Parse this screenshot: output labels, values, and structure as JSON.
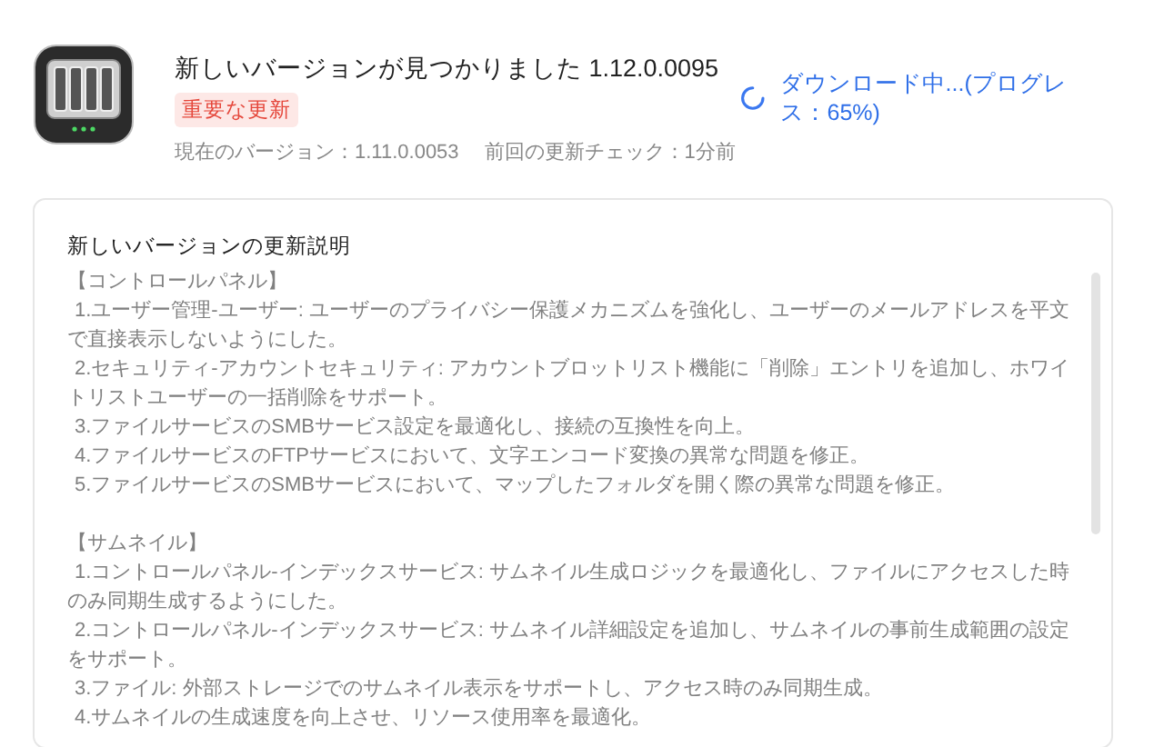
{
  "update": {
    "title": "新しいバージョンが見つかりました 1.12.0.0095",
    "badge": "重要な更新",
    "current_version": "現在のバージョン：1.11.0.0053",
    "last_check": "前回の更新チェック：1分前",
    "status": "ダウンロード中...(プログレス：65%)"
  },
  "notes": {
    "heading": "新しいバージョンの更新説明",
    "sections": [
      {
        "title": "【コントロールパネル】",
        "items": [
          "1.ユーザー管理-ユーザー: ユーザーのプライバシー保護メカニズムを強化し、ユーザーのメールアドレスを平文で直接表示しないようにした。",
          "2.セキュリティ-アカウントセキュリティ: アカウントブロットリスト機能に「削除」エントリを追加し、ホワイトリストユーザーの一括削除をサポート。",
          "3.ファイルサービスのSMBサービス設定を最適化し、接続の互換性を向上。",
          "4.ファイルサービスのFTPサービスにおいて、文字エンコード変換の異常な問題を修正。",
          "5.ファイルサービスのSMBサービスにおいて、マップしたフォルダを開く際の異常な問題を修正。"
        ]
      },
      {
        "title": "【サムネイル】",
        "items": [
          "1.コントロールパネル-インデックスサービス: サムネイル生成ロジックを最適化し、ファイルにアクセスした時のみ同期生成するようにした。",
          "2.コントロールパネル-インデックスサービス: サムネイル詳細設定を追加し、サムネイルの事前生成範囲の設定をサポート。",
          "3.ファイル: 外部ストレージでのサムネイル表示をサポートし、アクセス時のみ同期生成。",
          "4.サムネイルの生成速度を向上させ、リソース使用率を最適化。"
        ]
      }
    ]
  }
}
